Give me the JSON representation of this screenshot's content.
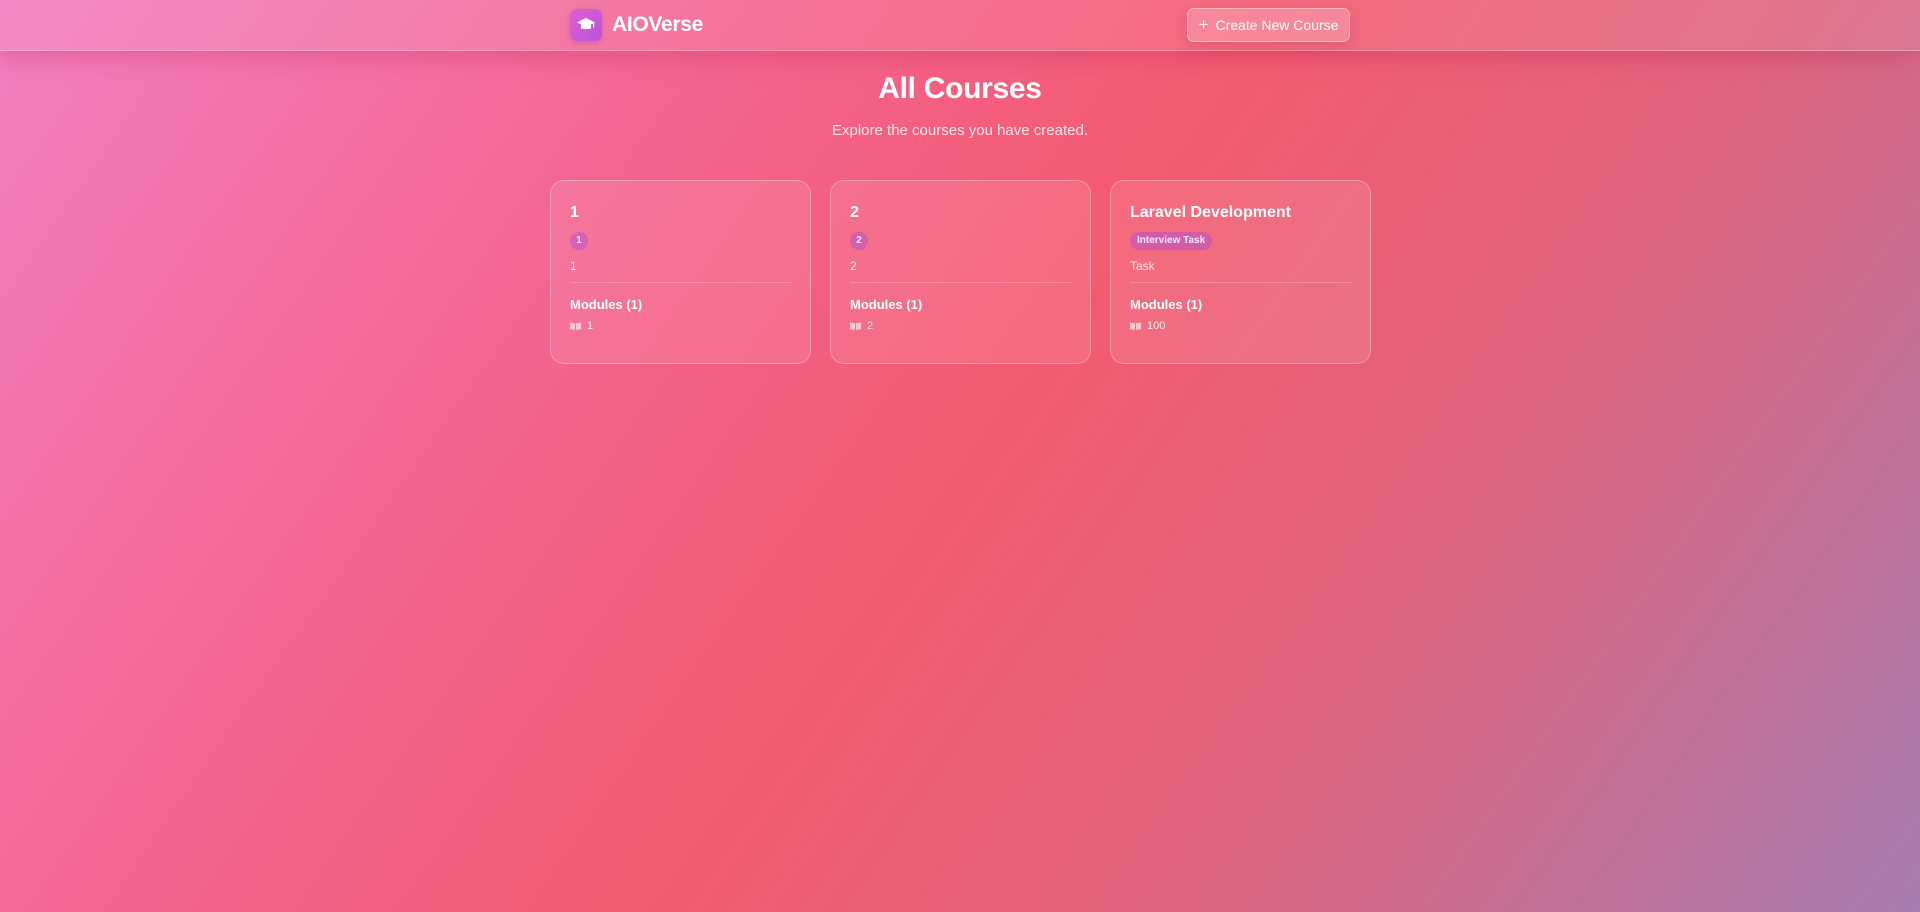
{
  "header": {
    "brand_name": "AIOVerse",
    "logo_icon": "graduation-cap-icon",
    "create_button_label": "Create New Course",
    "create_button_icon": "plus-icon"
  },
  "main": {
    "title": "All Courses",
    "subtitle": "Explore the courses you have created."
  },
  "courses": [
    {
      "title": "1",
      "badge": "1",
      "description": "1",
      "modules_heading": "Modules (1)",
      "modules": [
        "1"
      ]
    },
    {
      "title": "2",
      "badge": "2",
      "description": "2",
      "modules_heading": "Modules (1)",
      "modules": [
        "2"
      ]
    },
    {
      "title": "Laravel Development",
      "badge": "Interview Task",
      "description": "Task",
      "modules_heading": "Modules (1)",
      "modules": [
        "100"
      ]
    }
  ],
  "colors": {
    "gradient_start": "#f37ec0",
    "gradient_mid": "#f45a70",
    "gradient_end": "#a77cb0",
    "logo_gradient": "#c85ad8",
    "badge": "#b950c8"
  }
}
